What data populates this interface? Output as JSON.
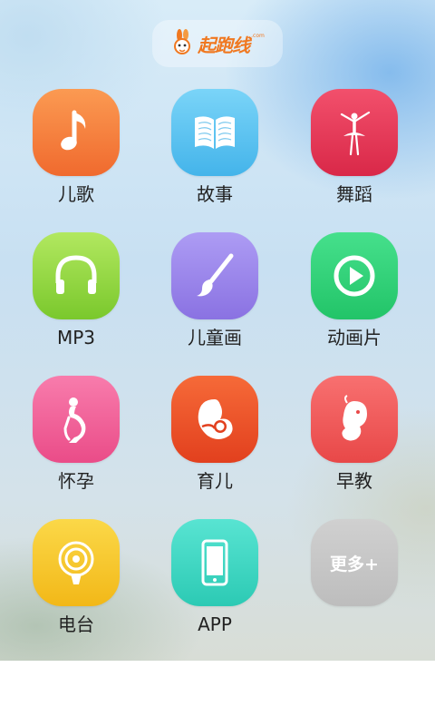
{
  "header": {
    "logo_text": "起跑线",
    "logo_suffix": ".com"
  },
  "colors": {
    "accent": "#f07820"
  },
  "apps": [
    {
      "label": "儿歌",
      "icon": "music-note-icon",
      "color": "#f47a3a"
    },
    {
      "label": "故事",
      "icon": "open-book-icon",
      "color": "#4fbfee"
    },
    {
      "label": "舞蹈",
      "icon": "ballerina-icon",
      "color": "#e33a5a"
    },
    {
      "label": "MP3",
      "icon": "headphones-icon",
      "color": "#8fd63c"
    },
    {
      "label": "儿童画",
      "icon": "paintbrush-icon",
      "color": "#9b86ea"
    },
    {
      "label": "动画片",
      "icon": "play-circle-icon",
      "color": "#2fd07a"
    },
    {
      "label": "怀孕",
      "icon": "pregnant-woman-icon",
      "color": "#f05f96"
    },
    {
      "label": "育儿",
      "icon": "mother-baby-icon",
      "color": "#f0502a"
    },
    {
      "label": "早教",
      "icon": "fetus-icon",
      "color": "#f0555a"
    },
    {
      "label": "电台",
      "icon": "radio-broadcast-icon",
      "color": "#f7c52a"
    },
    {
      "label": "APP",
      "icon": "smartphone-icon",
      "color": "#3cd8c4"
    },
    {
      "label": "",
      "icon": "more-icon",
      "color": "#c8c8c8",
      "tile_text": "更多+"
    }
  ]
}
